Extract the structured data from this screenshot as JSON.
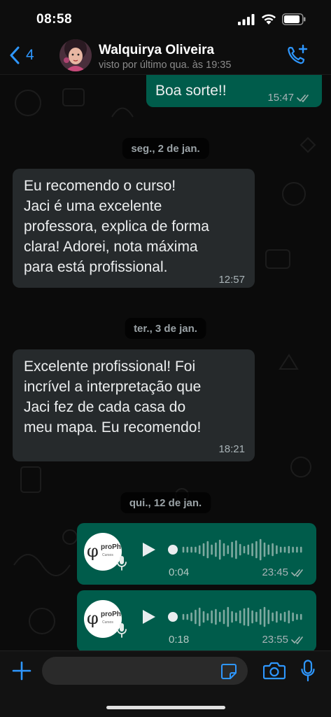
{
  "status_bar": {
    "time": "08:58",
    "icons": [
      "signal-icon",
      "wifi-icon",
      "battery-icon"
    ]
  },
  "header": {
    "back_count": "4",
    "contact_name": "Walquirya Oliveira",
    "contact_status": "visto por último qua. às 19:35",
    "icons": [
      "back-chevron-icon",
      "avatar",
      "add-call-icon"
    ]
  },
  "messages": [
    {
      "type": "out",
      "text": "Boa sorte!!",
      "time": "15:47",
      "status": "read"
    },
    {
      "type": "date",
      "text": "seg., 2 de jan."
    },
    {
      "type": "in",
      "lines": [
        "Eu recomendo o curso!",
        "Jaci é uma excelente",
        "professora, explica de forma",
        "clara! Adorei, nota máxima",
        "para está profissional."
      ],
      "time": "12:57"
    },
    {
      "type": "date",
      "text": "ter., 3 de jan."
    },
    {
      "type": "in",
      "lines": [
        "Excelente profissional! Foi",
        "incrível a interpretação que",
        "Jaci fez de cada casa do",
        "meu mapa. Eu recomendo!"
      ],
      "time": "18:21"
    },
    {
      "type": "date",
      "text": "qui., 12 de jan."
    },
    {
      "type": "voice",
      "duration": "0:04",
      "time": "23:45",
      "status": "read",
      "progress": 0.0,
      "logo_text": "proPhi",
      "logo_sub": "Cursos"
    },
    {
      "type": "voice",
      "duration": "0:18",
      "time": "23:55",
      "status": "read",
      "progress": 0.0,
      "logo_text": "proPhi",
      "logo_sub": "Cursos"
    }
  ],
  "input_bar": {
    "placeholder": "",
    "icons": [
      "plus-icon",
      "sticker-icon",
      "camera-icon",
      "microphone-icon"
    ]
  },
  "colors": {
    "accent": "#2e97ff",
    "outgoing_bubble": "#005c4b",
    "incoming_bubble": "#262a2c",
    "read_ticks": "#9fb3b0"
  }
}
